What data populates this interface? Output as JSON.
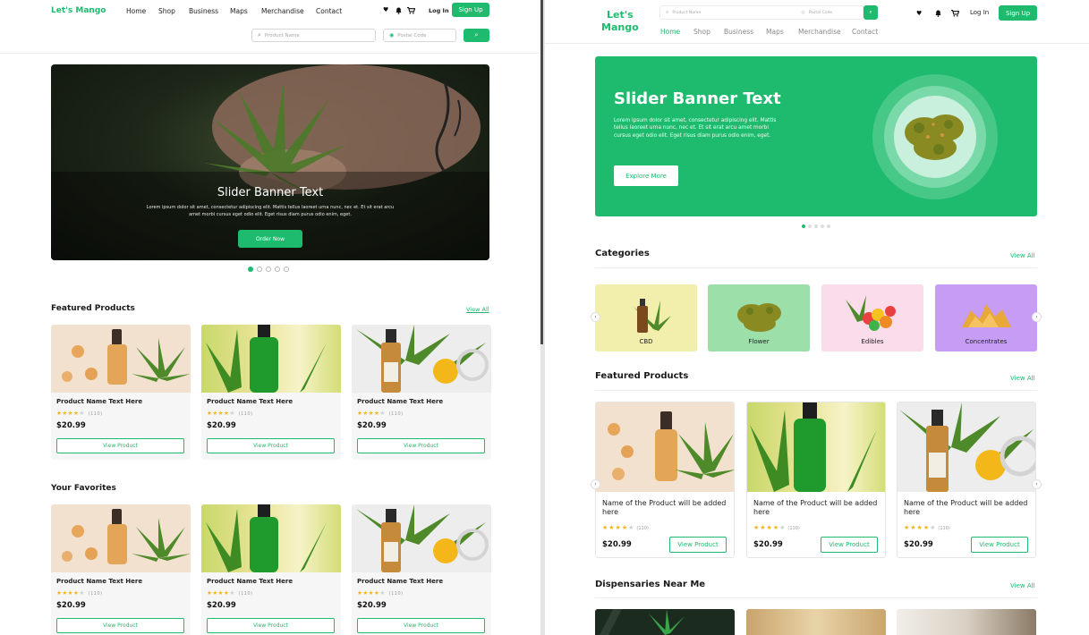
{
  "colors": {
    "accent": "#1ebb6e",
    "star": "#f3b51c"
  },
  "left": {
    "logo": "Let's Mango",
    "nav": [
      "Home",
      "Shop",
      "Business",
      "Maps",
      "Merchandise",
      "Contact"
    ],
    "icons": [
      "heart-icon",
      "bell-icon",
      "cart-icon"
    ],
    "login": "Log In",
    "signup": "Sign Up",
    "search_placeholder": "Product Name",
    "postal_placeholder": "Postal Code",
    "banner": {
      "title": "Slider Banner Text",
      "text_line1": "Lorem ipsum dolor sit amet, consectetur adipiscing elit. Mattis tellus laoreet urna nunc, nec et. Et sit erat arcu",
      "text_line2": "amet morbi cursus eget odio elit. Eget risus diam purus odio enim, eget.",
      "button": "Order Now",
      "active_slide": 1,
      "slide_count": 5
    },
    "featured": {
      "title": "Featured Products",
      "view_all": "View All",
      "cards": [
        {
          "name": "Product Name Text Here",
          "reviews": "(110)",
          "price": "$20.99",
          "button": "View Product",
          "rating": 4
        },
        {
          "name": "Product Name Text Here",
          "reviews": "(110)",
          "price": "$20.99",
          "button": "View Product",
          "rating": 4
        },
        {
          "name": "Product Name Text Here",
          "reviews": "(110)",
          "price": "$20.99",
          "button": "View Product",
          "rating": 4
        }
      ]
    },
    "favorites": {
      "title": "Your Favorites",
      "cards": [
        {
          "name": "Product Name Text Here",
          "reviews": "(110)",
          "price": "$20.99",
          "button": "View Product",
          "rating": 4
        },
        {
          "name": "Product Name Text Here",
          "reviews": "(110)",
          "price": "$20.99",
          "button": "View Product",
          "rating": 4
        },
        {
          "name": "Product Name Text Here",
          "reviews": "(110)",
          "price": "$20.99",
          "button": "View Product",
          "rating": 4
        }
      ]
    }
  },
  "right": {
    "logo_line1": "Let's",
    "logo_line2": "Mango",
    "search_placeholder": "Product Name",
    "postal_placeholder": "Postal Code",
    "nav": [
      "Home",
      "Shop",
      "Business",
      "Maps",
      "Merchandise",
      "Contact"
    ],
    "login": "Log In",
    "signup": "Sign Up",
    "banner": {
      "title": "Slider Banner Text",
      "text": "Lorem ipsum dolor sit amet, consectetur adipiscing elit. Mattis tellus laoreet urna nunc, nec et. Et sit erat arcu amet morbi cursus eget odio elit. Eget risus diam purus odio enim, eget.",
      "button": "Explore More",
      "active_slide": 1,
      "slide_count": 5
    },
    "categories": {
      "title": "Categories",
      "view_all": "View All",
      "items": [
        {
          "label": "CBD",
          "color": "#f2eeac"
        },
        {
          "label": "Flower",
          "color": "#9ddfa9"
        },
        {
          "label": "Edibles",
          "color": "#fbdcea"
        },
        {
          "label": "Concentrates",
          "color": "#c69cf5"
        }
      ]
    },
    "featured": {
      "title": "Featured Products",
      "view_all": "View All",
      "cards": [
        {
          "name": "Name of the Product will be added here",
          "reviews": "(110)",
          "price": "$20.99",
          "button": "View Product",
          "rating": 4
        },
        {
          "name": "Name of the Product will be added here",
          "reviews": "(110)",
          "price": "$20.99",
          "button": "View Product",
          "rating": 4
        },
        {
          "name": "Name of the Product will be added here",
          "reviews": "(110)",
          "price": "$20.99",
          "button": "View Product",
          "rating": 4
        }
      ]
    },
    "dispensaries": {
      "title": "Dispensaries Near Me",
      "view_all": "View All"
    }
  }
}
